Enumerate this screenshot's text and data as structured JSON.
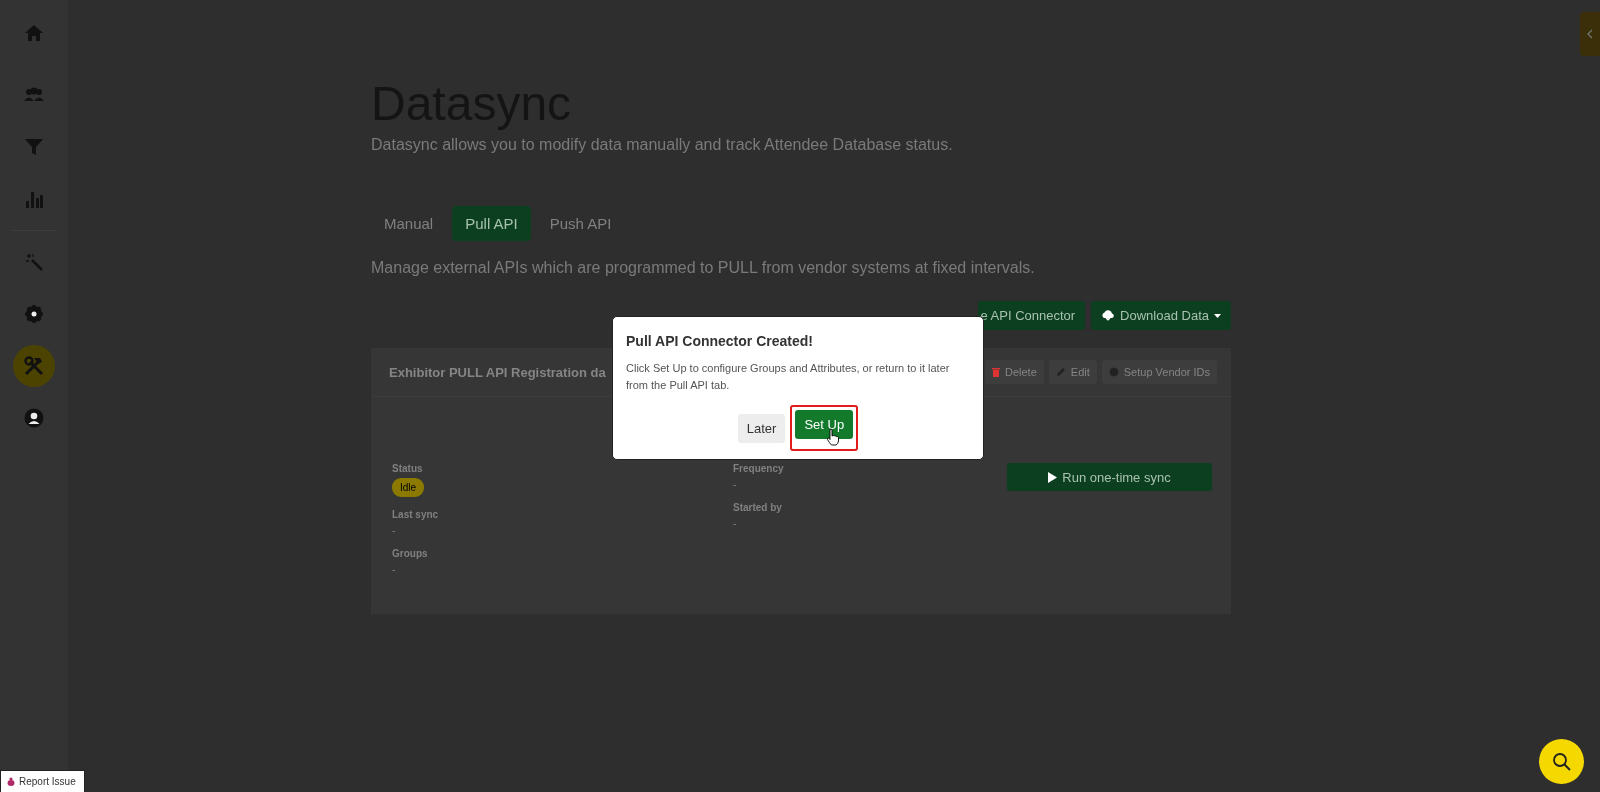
{
  "sidebar": {
    "items": [
      {
        "kind": "home",
        "selected": false
      },
      {
        "kind": "people",
        "selected": false
      },
      {
        "kind": "filter",
        "selected": false
      },
      {
        "kind": "chart",
        "selected": false
      },
      {
        "kind": "divider"
      },
      {
        "kind": "wand",
        "selected": false
      },
      {
        "kind": "gear",
        "selected": false
      },
      {
        "kind": "tools",
        "selected": true
      },
      {
        "kind": "user",
        "selected": false
      }
    ]
  },
  "page": {
    "title": "Datasync",
    "subtitle": "Datasync allows you to modify data manually and track Attendee Database status."
  },
  "tabs": [
    {
      "label": "Manual",
      "selected": false
    },
    {
      "label": "Pull API",
      "selected": true
    },
    {
      "label": "Push API",
      "selected": false
    }
  ],
  "description": "Manage external APIs which are programmed to PULL from vendor systems at fixed intervals.",
  "toolbar": {
    "create_button": "e API Connector",
    "download_button": "Download Data"
  },
  "card": {
    "title": "Exhibitor PULL API Registration da",
    "actions": [
      {
        "kind": "trash",
        "label": "Delete"
      },
      {
        "kind": "pencil",
        "label": "Edit"
      },
      {
        "kind": "gear",
        "label": "Setup Vendor IDs"
      }
    ],
    "columns": [
      [
        {
          "label": "Status",
          "kind": "badge",
          "value": "Idle",
          "color": "#8c7a00"
        },
        {
          "label": "Last sync",
          "kind": "text",
          "value": "-"
        },
        {
          "label": "Groups",
          "kind": "text",
          "value": "-"
        }
      ],
      [
        {
          "label": "Frequency",
          "kind": "text",
          "value": "-"
        },
        {
          "label": "Started by",
          "kind": "text",
          "value": "-"
        }
      ]
    ],
    "run_button": "Run one-time sync"
  },
  "modal": {
    "title": "Pull API Connector Created!",
    "body": "Click Set Up to configure Groups and Attributes, or return to it later from the Pull API tab.",
    "buttons": [
      {
        "label": "Later",
        "kind": "secondary",
        "highlighted": false
      },
      {
        "label": "Set Up",
        "kind": "primary",
        "highlighted": true
      }
    ]
  },
  "report_button": "Report Issue"
}
